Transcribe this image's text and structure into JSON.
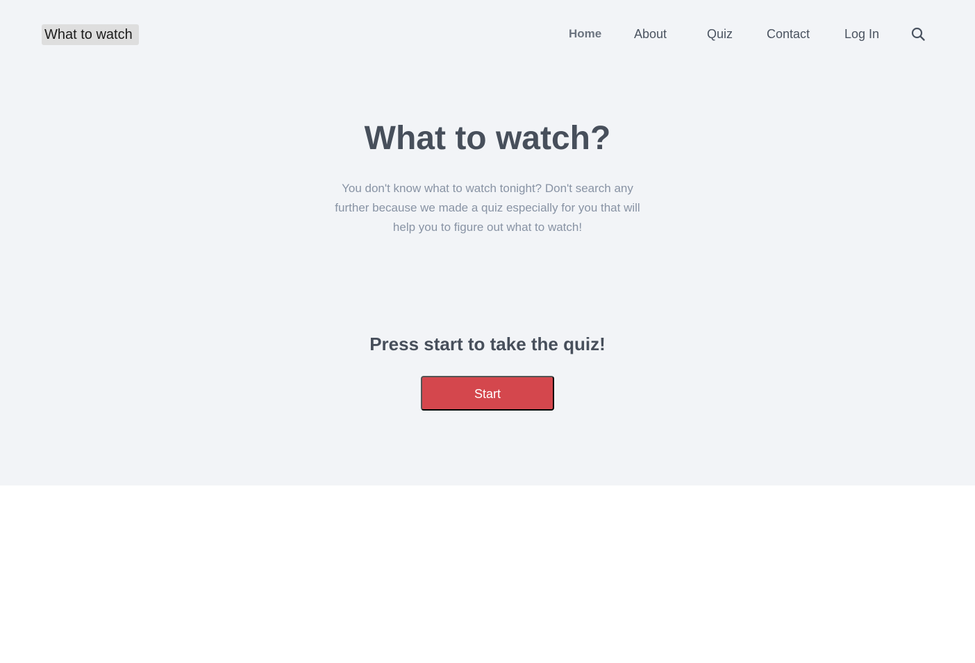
{
  "header": {
    "brand": "What to watch",
    "nav": [
      "Home",
      "About",
      "Quiz",
      "Contact",
      "Log In"
    ],
    "search_icon": "search-icon"
  },
  "hero": {
    "title": "What to watch?",
    "description": "You don't know what to watch tonight? Don't search any further because we made a quiz especially for you that will help you to figure out what to watch!",
    "prompt": "Press start to take the quiz!",
    "start_label": "Start"
  },
  "colors": {
    "hero_background": "#f2f4f7",
    "start_button": "#d4474d",
    "title_text": "#474f5b",
    "description_text": "#8893a4"
  }
}
